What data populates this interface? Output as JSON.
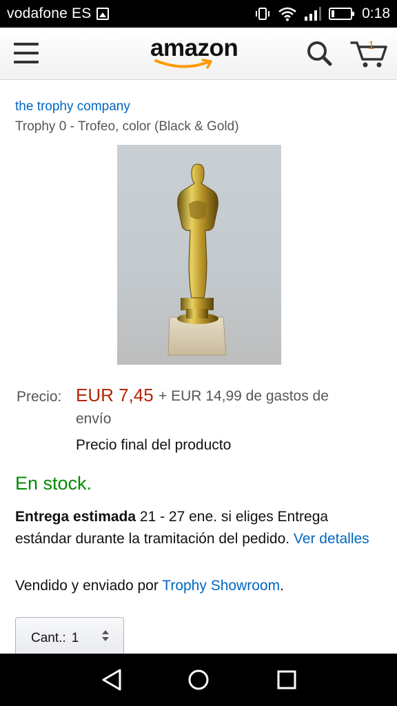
{
  "status_bar": {
    "carrier": "vodafone ES",
    "time": "0:18"
  },
  "header": {
    "logo_text": "amazon",
    "cart_count": "1",
    "icons": [
      "menu-icon",
      "search-icon",
      "cart-icon"
    ]
  },
  "product": {
    "brand": "the trophy company",
    "title": "Trophy 0 - Trofeo, color (Black & Gold)",
    "price_label": "Precio:",
    "price": "EUR 7,45",
    "shipping_line1": "+ EUR 14,99 de gastos de",
    "shipping_line2": "envío",
    "final_note": "Precio final del producto",
    "stock": "En stock.",
    "delivery_bold": "Entrega estimada",
    "delivery_text": " 21 - 27 ene. si eliges Entrega estándar durante la tramitación del pedido. ",
    "delivery_link": "Ver detalles",
    "sold_prefix": "Vendido y enviado por ",
    "seller": "Trophy Showroom",
    "sold_suffix": ".",
    "qty_label": "Cant.:",
    "qty_value": "1"
  },
  "colors": {
    "price": "#b12704",
    "link": "#0066c0",
    "stock": "#008a00",
    "smile": "#ff9900"
  },
  "nav_bar": {
    "icons": [
      "back-icon",
      "home-icon",
      "recents-icon"
    ]
  }
}
